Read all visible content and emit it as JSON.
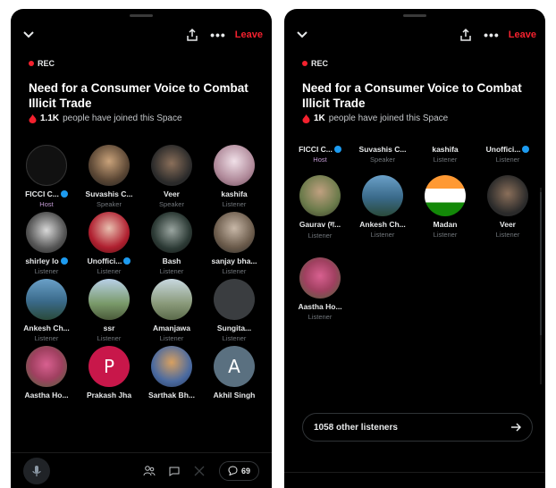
{
  "space": {
    "rec_label": "REC",
    "title": "Need for a Consumer Voice to Combat Illicit Trade",
    "joined_count_left": "1.1K",
    "joined_count_right": "1K",
    "joined_suffix": "people have joined this Space",
    "leave_label": "Leave",
    "more_label": "•••"
  },
  "left_participants": [
    {
      "name": "FICCI C...",
      "role": "Host",
      "verified": true
    },
    {
      "name": "Suvashis C...",
      "role": "Speaker",
      "verified": false
    },
    {
      "name": "Veer",
      "role": "Speaker",
      "verified": false
    },
    {
      "name": "kashifa",
      "role": "Listener",
      "verified": false
    },
    {
      "name": "shirley lo",
      "role": "Listener",
      "verified": true
    },
    {
      "name": "Unoffici...",
      "role": "Listener",
      "verified": true
    },
    {
      "name": "Bash",
      "role": "Listener",
      "verified": false
    },
    {
      "name": "sanjay bha...",
      "role": "Listener",
      "verified": false
    },
    {
      "name": "Ankesh Ch...",
      "role": "Listener",
      "verified": false
    },
    {
      "name": "ssr",
      "role": "Listener",
      "verified": false
    },
    {
      "name": "Amanjawa",
      "role": "Listener",
      "verified": false
    },
    {
      "name": "Sungita...",
      "role": "Listener",
      "verified": false
    },
    {
      "name": "Aastha Ho...",
      "role": "",
      "verified": false
    },
    {
      "name": "Prakash Jha",
      "role": "",
      "verified": false,
      "letter": "P"
    },
    {
      "name": "Sarthak Bh...",
      "role": "",
      "verified": false
    },
    {
      "name": "Akhil Singh",
      "role": "",
      "verified": false,
      "letter": "A"
    }
  ],
  "right_participants_top": [
    {
      "name": "FICCI C...",
      "role": "Host",
      "verified": true
    },
    {
      "name": "Suvashis C...",
      "role": "Speaker",
      "verified": false
    },
    {
      "name": "kashifa",
      "role": "Listener",
      "verified": false
    },
    {
      "name": "Unoffici...",
      "role": "Listener",
      "verified": true
    }
  ],
  "right_participants": [
    {
      "name": "Gaurav (ग...",
      "role": "Listener",
      "verified": false
    },
    {
      "name": "Ankesh Ch...",
      "role": "Listener",
      "verified": false
    },
    {
      "name": "Madan",
      "role": "Listener",
      "verified": false
    },
    {
      "name": "Veer",
      "role": "Listener",
      "verified": false
    },
    {
      "name": "Aastha Ho...",
      "role": "Listener",
      "verified": false
    }
  ],
  "other_listeners_label": "1058 other listeners",
  "reply_count": "69",
  "colors": {
    "accent_red": "#f4212e",
    "verified_blue": "#1d9bf0",
    "background": "#000000"
  }
}
